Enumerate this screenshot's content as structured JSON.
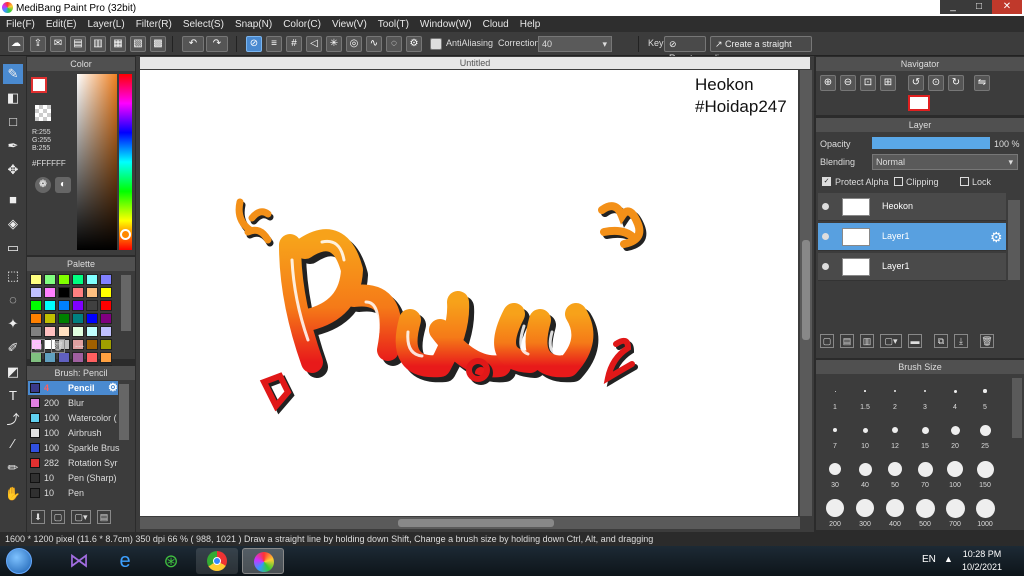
{
  "window": {
    "title": "MediBang Paint Pro (32bit)",
    "minimize": "_",
    "maximize": "□",
    "close": "✕"
  },
  "menu": [
    "File(F)",
    "Edit(E)",
    "Layer(L)",
    "Filter(R)",
    "Select(S)",
    "Snap(N)",
    "Color(C)",
    "View(V)",
    "Tool(T)",
    "Window(W)",
    "Cloud",
    "Help"
  ],
  "toolbar": {
    "antialiasing": "AntiAliasing",
    "correction_label": "Correction",
    "correction_value": "40",
    "key_label": "Key",
    "reset": "Reset",
    "straight_line": "Create a straight line"
  },
  "color_panel": {
    "title": "Color",
    "r": "R:255",
    "g": "G:255",
    "b": "B:255",
    "hex": "#FFFFFF"
  },
  "palette_panel": {
    "title": "Palette",
    "footer": "---"
  },
  "brush_panel": {
    "title": "Brush: Pencil",
    "items": [
      {
        "size": "4",
        "name": "Pencil",
        "color": "#3a3a8a"
      },
      {
        "size": "200",
        "name": "Blur",
        "color": "#e080e0"
      },
      {
        "size": "100",
        "name": "Watercolor (",
        "color": "#60d0f0"
      },
      {
        "size": "100",
        "name": "Airbrush",
        "color": "#e0e0e0"
      },
      {
        "size": "100",
        "name": "Sparkle Brus",
        "color": "#3050e0"
      },
      {
        "size": "282",
        "name": "Rotation Syr",
        "color": "#e03030"
      },
      {
        "size": "10",
        "name": "Pen (Sharp)",
        "color": "#303030"
      },
      {
        "size": "10",
        "name": "Pen",
        "color": "#303030"
      }
    ]
  },
  "canvas": {
    "tab": "Untitled",
    "signature_line1": "Heokon",
    "signature_line2": "#Hoidap247"
  },
  "navigator": {
    "title": "Navigator"
  },
  "layer_panel": {
    "title": "Layer",
    "opacity_label": "Opacity",
    "opacity_value": "100 %",
    "opacity_fraction": 1.0,
    "blending_label": "Blending",
    "blending_value": "Normal",
    "protect_alpha": "Protect Alpha",
    "clipping": "Clipping",
    "lock": "Lock",
    "layers": [
      {
        "name": "Heokon",
        "selected": false
      },
      {
        "name": "Layer1",
        "selected": true
      },
      {
        "name": "Layer1",
        "selected": false
      }
    ]
  },
  "brush_size": {
    "title": "Brush Size",
    "sizes": [
      "1",
      "1.5",
      "2",
      "3",
      "4",
      "5",
      "7",
      "10",
      "12",
      "15",
      "20",
      "25",
      "30",
      "40",
      "50",
      "70",
      "100",
      "150",
      "200",
      "300",
      "400",
      "500",
      "700",
      "1000"
    ]
  },
  "status": "1600 * 1200 pixel  (11.6 * 8.7cm)  350 dpi  66 %  ( 988, 1021 )  Draw a straight line by holding down Shift, Change a brush size by holding down Ctrl, Alt, and dragging",
  "taskbar": {
    "lang": "EN",
    "time": "10:28 PM",
    "date": "10/2/2021"
  }
}
